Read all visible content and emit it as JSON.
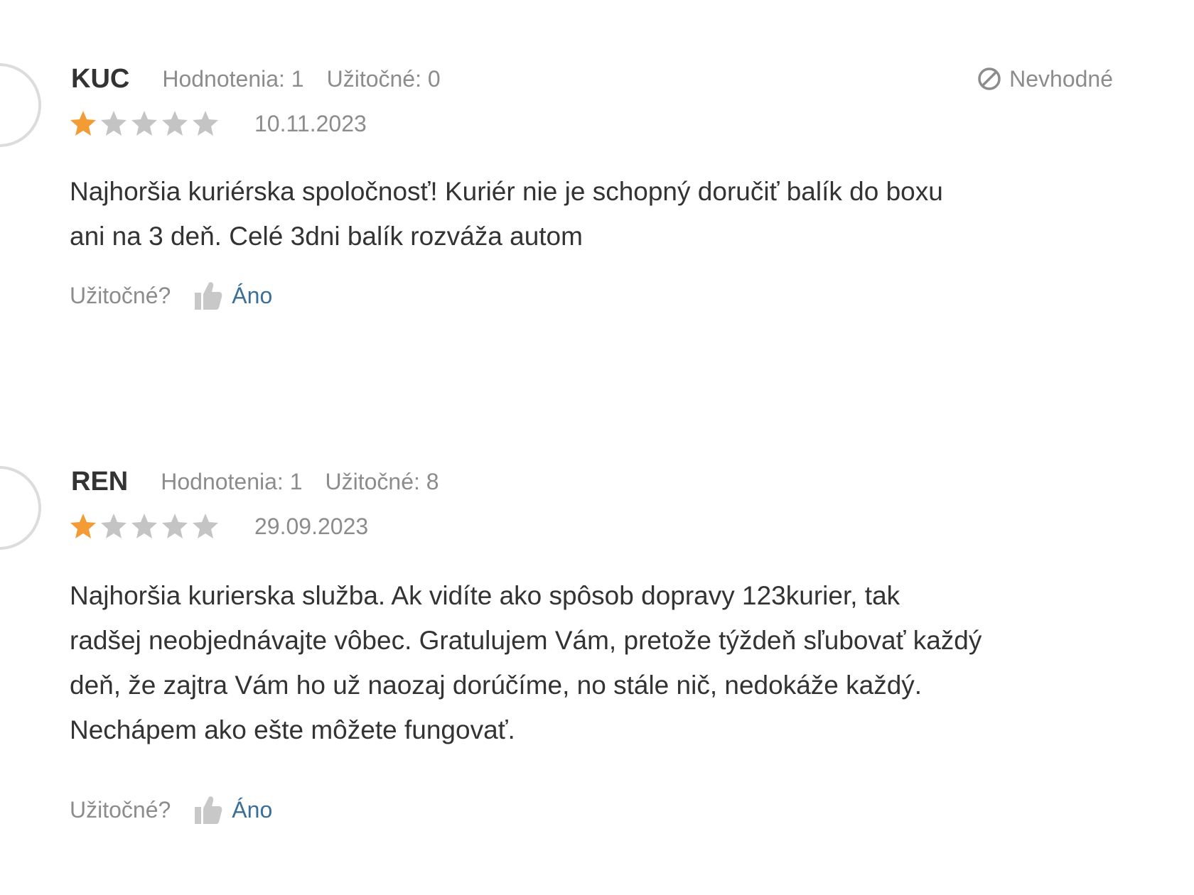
{
  "reviews": [
    {
      "author": "KUC",
      "ratings_count": "Hodnotenia: 1",
      "useful_count": "Užitočné: 0",
      "report_label": "Nevhodné",
      "stars": 1,
      "date": "10.11.2023",
      "text": "Najhoršia kuriérska spoločnosť! Kuriér nie je schopný doručiť balík do boxu\nani na 3 deň. Celé 3dni balík rozváža autom",
      "useful_question": "Užitočné?",
      "yes_label": "Áno"
    },
    {
      "author": "REN",
      "ratings_count": "Hodnotenia: 1",
      "useful_count": "Užitočné: 8",
      "stars": 1,
      "date": "29.09.2023",
      "text": "Najhoršia kurierska služba. Ak vidíte ako spôsob dopravy 123kurier, tak\nradšej neobjednávajte vôbec. Gratulujem Vám, pretože týždeň sľubovať každý\ndeň, že zajtra Vám ho už naozaj dorúčíme, no stále nič, nedokáže každý.\nNechápem ako ešte môžete fungovať.",
      "useful_question": "Užitočné?",
      "yes_label": "Áno"
    }
  ],
  "icons": {
    "report": "prohibited-icon",
    "thumb": "thumbs-up-icon",
    "star": "star-icon"
  },
  "colors": {
    "star_filled": "#f39c35",
    "star_empty": "#c4c4c4",
    "link": "#3a6f99",
    "muted": "#8c8c8c",
    "text": "#333333"
  }
}
